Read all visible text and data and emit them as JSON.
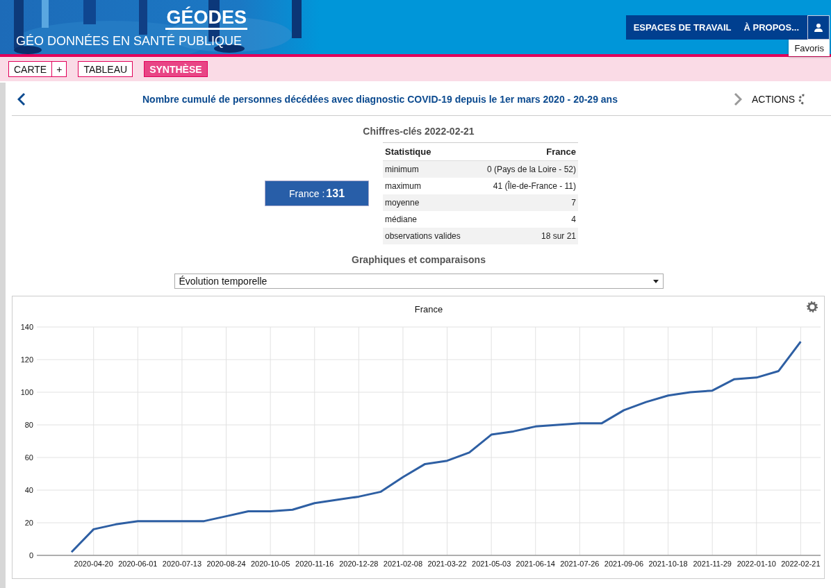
{
  "header": {
    "logo": "GÉODES",
    "subtitle": "GÉO DONNÉES EN SANTÉ PUBLIQUE",
    "nav": [
      "ESPACES DE TRAVAIL",
      "À PROPOS..."
    ],
    "tooltip": "Favoris"
  },
  "tabs": [
    {
      "label": "CARTE",
      "selected": false,
      "extra": "+"
    },
    {
      "label": "TABLEAU",
      "selected": false
    },
    {
      "label": "SYNTHÈSE",
      "selected": true
    }
  ],
  "indicator": {
    "title": "Nombre cumulé de personnes décédées avec diagnostic COVID-19 depuis le 1er mars 2020 - 20-29 ans",
    "actions": "ACTIONS"
  },
  "key_figures": {
    "title": "Chiffres-clés 2022-02-21",
    "badge_label": "France : ",
    "badge_value": "131",
    "columns": [
      "Statistique",
      "France"
    ],
    "rows": [
      [
        "minimum",
        "0 (Pays de la Loire - 52)"
      ],
      [
        "maximum",
        "41 (Île-de-France - 11)"
      ],
      [
        "moyenne",
        "7"
      ],
      [
        "médiane",
        "4"
      ],
      [
        "observations valides",
        "18 sur 21"
      ]
    ]
  },
  "charts_section": {
    "title": "Graphiques et comparaisons",
    "select": "Évolution temporelle"
  },
  "chart": {
    "chart_data": {
      "type": "line",
      "title": "France",
      "categories": [
        null,
        null,
        "2020-04-20",
        null,
        "2020-06-01",
        null,
        "2020-07-13",
        null,
        "2020-08-24",
        null,
        "2020-10-05",
        null,
        "2020-11-16",
        null,
        "2020-12-28",
        null,
        "2021-02-08",
        null,
        "2021-03-22",
        null,
        "2021-05-03",
        null,
        "2021-06-14",
        null,
        "2021-07-26",
        null,
        "2021-09-06",
        null,
        "2021-10-18",
        null,
        "2021-11-29",
        null,
        "2022-01-10",
        null,
        "2022-02-21"
      ],
      "series": [
        {
          "color": "#2e5fa3",
          "values": [
            null,
            2,
            16,
            19,
            21,
            21,
            21,
            21,
            24,
            27,
            27,
            28,
            32,
            34,
            36,
            39,
            48,
            56,
            58,
            63,
            74,
            76,
            79,
            80,
            81,
            81,
            89,
            94,
            98,
            100,
            101,
            108,
            109,
            113,
            131
          ]
        }
      ],
      "ylim": [
        0,
        140
      ],
      "grid": true,
      "yticks": [
        0,
        20,
        40,
        60,
        80,
        100,
        120,
        140
      ]
    }
  }
}
